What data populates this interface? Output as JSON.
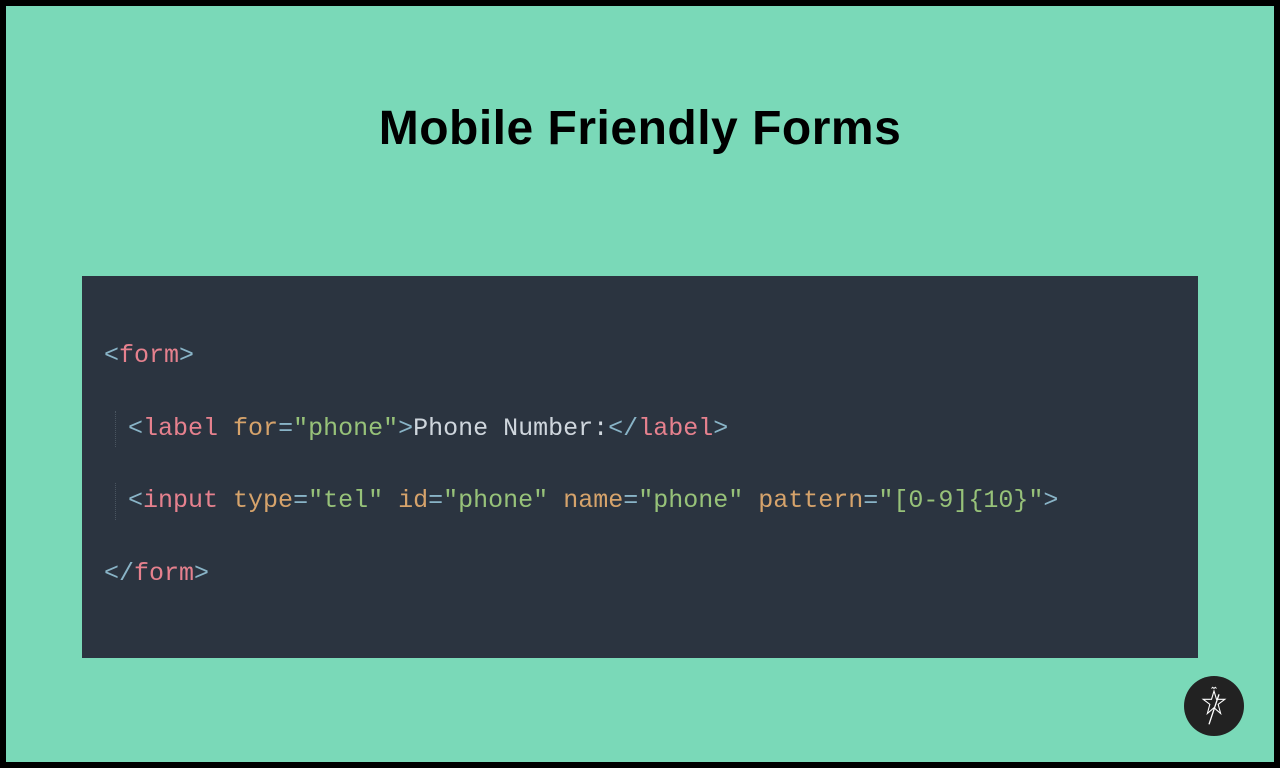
{
  "title": "Mobile Friendly Forms",
  "code": {
    "line1": {
      "open": "<",
      "tag": "form",
      "close": ">"
    },
    "line2": {
      "open": "<",
      "tag": "label",
      "sp": " ",
      "attr1": "for",
      "eq": "=",
      "val1": "\"phone\"",
      "close1": ">",
      "text": "Phone Number:",
      "open2": "</",
      "tag2": "label",
      "close2": ">"
    },
    "line3": {
      "open": "<",
      "tag": "input",
      "sp": " ",
      "attr1": "type",
      "eq1": "=",
      "val1": "\"tel\"",
      "sp1": " ",
      "attr2": "id",
      "eq2": "=",
      "val2": "\"phone\"",
      "sp2": " ",
      "attr3": "name",
      "eq3": "=",
      "val3": "\"phone\"",
      "sp3": " ",
      "attr4": "pattern",
      "eq4": "=",
      "val4": "\"[0-9]{10}\"",
      "close": ">"
    },
    "line4": {
      "open": "</",
      "tag": "form",
      "close": ">"
    }
  }
}
